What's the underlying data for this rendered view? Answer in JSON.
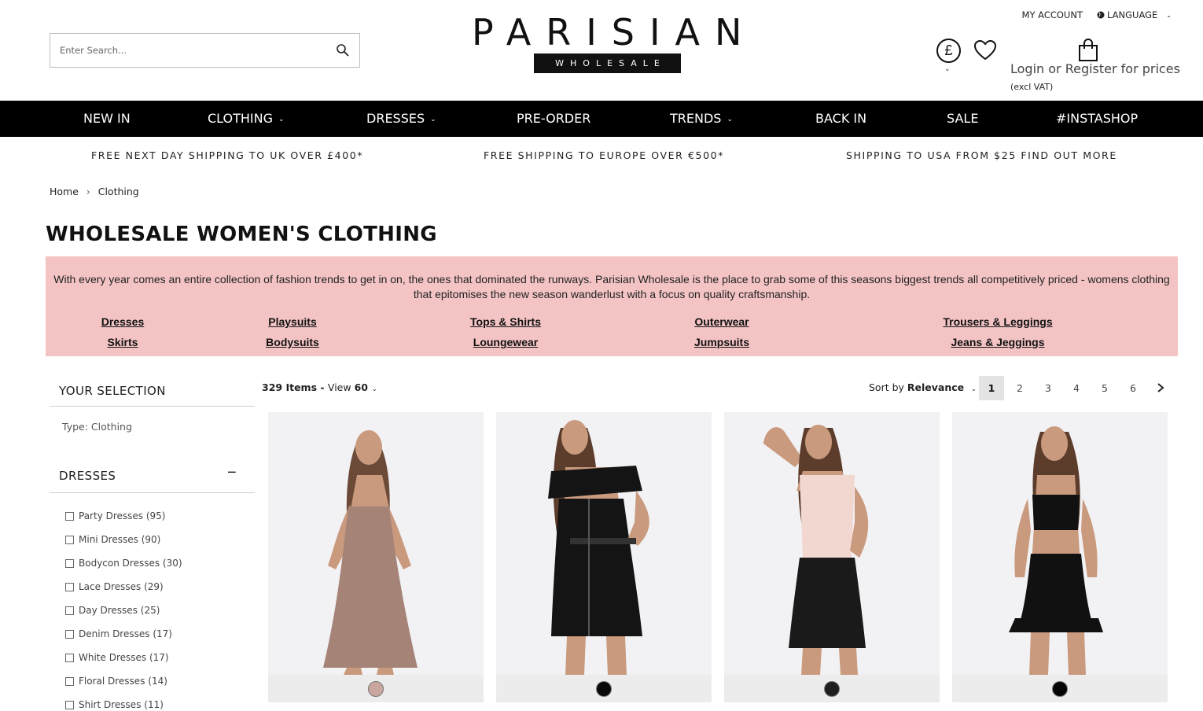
{
  "header": {
    "search_placeholder": "Enter Search...",
    "logo_main": "PARISIAN",
    "logo_sub": "WHOLESALE",
    "my_account": "MY ACCOUNT",
    "language": "LANGUAGE",
    "currency_symbol": "£",
    "login_text": "Login or Register for prices",
    "vat_text": "(excl VAT)"
  },
  "nav": {
    "items": [
      {
        "label": "NEW IN"
      },
      {
        "label": "CLOTHING"
      },
      {
        "label": "DRESSES"
      },
      {
        "label": "PRE-ORDER"
      },
      {
        "label": "TRENDS"
      },
      {
        "label": "BACK IN"
      },
      {
        "label": "SALE"
      },
      {
        "label": "#INSTASHOP"
      }
    ]
  },
  "promo": [
    "FREE NEXT DAY SHIPPING TO UK OVER £400*",
    "FREE SHIPPING TO EUROPE OVER €500*",
    "SHIPPING TO USA FROM $25 FIND OUT MORE"
  ],
  "breadcrumb": {
    "home": "Home",
    "separator": "›",
    "current": "Clothing"
  },
  "page_title": "WHOLESALE WOMEN'S CLOTHING",
  "intro": {
    "text": "With every year comes an entire collection of fashion trends to get in on, the ones that dominated the runways. Parisian Wholesale is the place to grab some of this seasons biggest trends all competitively priced - womens clothing that epitomises the new season wanderlust with a focus on quality craftsmanship.",
    "links": [
      "Dresses",
      "Playsuits",
      "Tops & Shirts",
      "Outerwear",
      "Trousers & Leggings",
      "Skirts",
      "Bodysuits",
      "Loungewear",
      "Jumpsuits",
      "Jeans & Jeggings"
    ]
  },
  "sidebar": {
    "selection_heading": "YOUR SELECTION",
    "selection_value": "Type: Clothing",
    "dresses_heading": "DRESSES",
    "collapse_symbol": "−",
    "filters": [
      "Party Dresses (95)",
      "Mini Dresses (90)",
      "Bodycon Dresses (30)",
      "Lace Dresses (29)",
      "Day Dresses (25)",
      "Denim Dresses (17)",
      "White Dresses (17)",
      "Floral Dresses (14)",
      "Shirt Dresses (11)"
    ]
  },
  "toolbar": {
    "items_count": "329 Items",
    "view_prefix": "View",
    "view_value": "60",
    "sort_prefix": "Sort by",
    "sort_value": "Relevance",
    "pages": [
      "1",
      "2",
      "3",
      "4",
      "5",
      "6"
    ],
    "active_page": "1"
  },
  "products": [
    {
      "swatch_color": "#c9a79f",
      "dress_color": "#a58377"
    },
    {
      "swatch_color": "#0a0a0a",
      "dress_color": "#141414"
    },
    {
      "swatch_color": "#1e1e1e",
      "dress_color": "#1a1a1a"
    },
    {
      "swatch_color": "#050505",
      "dress_color": "#111111"
    }
  ]
}
